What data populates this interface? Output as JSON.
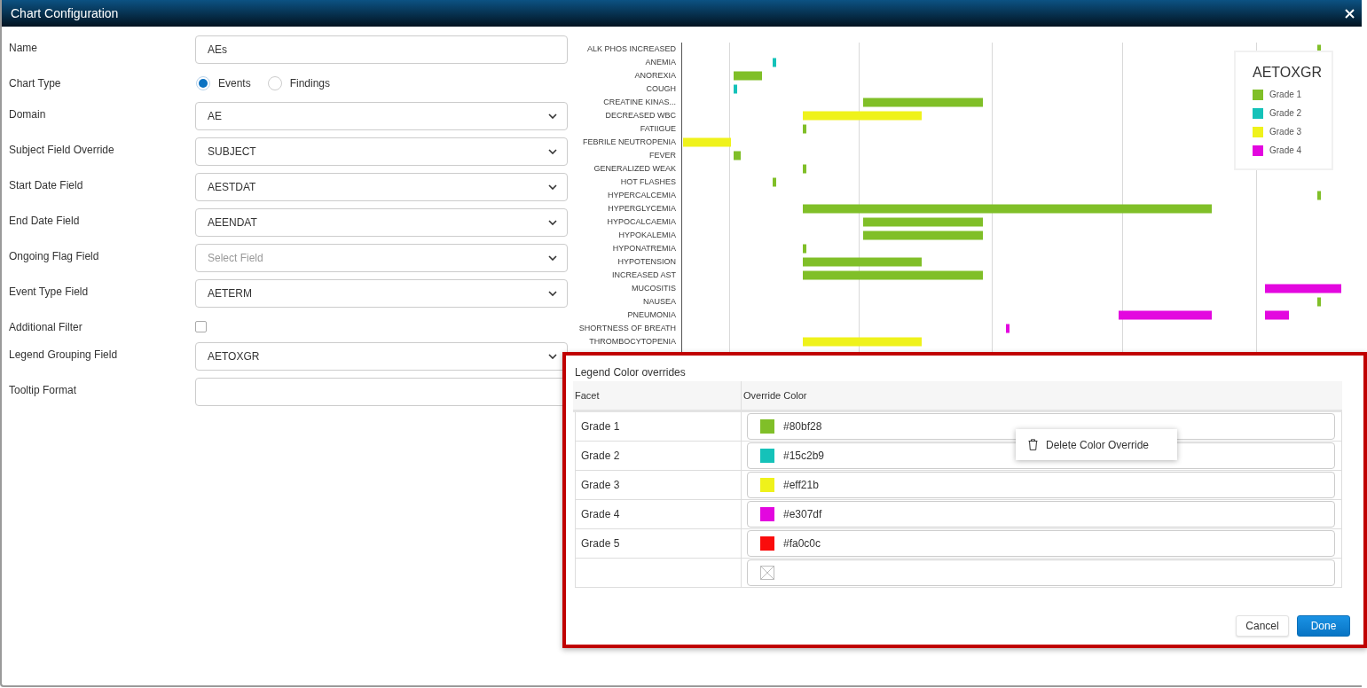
{
  "window": {
    "title": "Chart Configuration"
  },
  "form": {
    "fields": [
      {
        "kind": "text",
        "label": "Name",
        "value": "AEs"
      },
      {
        "kind": "radio",
        "label": "Chart Type",
        "options": [
          {
            "label": "Events",
            "selected": true
          },
          {
            "label": "Findings",
            "selected": false
          }
        ]
      },
      {
        "kind": "select",
        "label": "Domain",
        "value": "AE"
      },
      {
        "kind": "select",
        "label": "Subject Field Override",
        "value": "SUBJECT"
      },
      {
        "kind": "select",
        "label": "Start Date Field",
        "value": "AESTDAT"
      },
      {
        "kind": "select",
        "label": "End Date Field",
        "value": "AEENDAT"
      },
      {
        "kind": "select",
        "label": "Ongoing Flag Field",
        "placeholder": "Select Field"
      },
      {
        "kind": "select",
        "label": "Event Type Field",
        "value": "AETERM"
      },
      {
        "kind": "checkbox",
        "label": "Additional Filter",
        "checked": false
      },
      {
        "kind": "select",
        "label": "Legend Grouping Field",
        "value": "AETOXGR"
      },
      {
        "kind": "text",
        "label": "Tooltip Format"
      }
    ]
  },
  "chart": {
    "row_labels": [
      "ALK PHOS INCREASED",
      "ANEMIA",
      "ANOREXIA",
      "COUGH",
      "CREATINE KINAS...",
      "DECREASED WBC",
      "FATIIGUE",
      "FEBRILE NEUTROPENIA",
      "FEVER",
      "GENERALIZED WEAK",
      "HOT FLASHES",
      "HYPERCALCEMIA",
      "HYPERGLYCEMIA",
      "HYPOCALCAEMIA",
      "HYPOKALEMIA",
      "HYPONATREMIA",
      "HYPOTENSION",
      "INCREASED AST",
      "MUCOSITIS",
      "NAUSEA",
      "PNEUMONIA",
      "SHORTNESS OF BREATH",
      "THROMBOCYTOPENIA"
    ],
    "legend": {
      "title": "AETOXGR",
      "items": [
        {
          "label": "Grade 1",
          "color": "#80bf28"
        },
        {
          "label": "Grade 2",
          "color": "#15c2b9"
        },
        {
          "label": "Grade 3",
          "color": "#eff21b"
        },
        {
          "label": "Grade 4",
          "color": "#e307df"
        }
      ]
    }
  },
  "overrides_panel": {
    "title": "Legend Color overrides",
    "columns": [
      "Facet",
      "Override Color"
    ],
    "rows": [
      {
        "kind": "color",
        "facet": "Grade 1",
        "color": "#80bf28",
        "value": "#80bf28"
      },
      {
        "kind": "color",
        "facet": "Grade 2",
        "color": "#15c2b9",
        "value": "#15c2b9"
      },
      {
        "kind": "color",
        "facet": "Grade 3",
        "color": "#eff21b",
        "value": "#eff21b"
      },
      {
        "kind": "color",
        "facet": "Grade 4",
        "color": "#e307df",
        "value": "#e307df"
      },
      {
        "kind": "color",
        "facet": "Grade 5",
        "color": "#fa0c0c",
        "value": "#fa0c0c"
      },
      {
        "kind": "empty"
      }
    ],
    "context_menu": {
      "items": [
        {
          "label": "Delete Color Override"
        }
      ]
    },
    "buttons": [
      {
        "kind": "cancel",
        "label": "Cancel"
      },
      {
        "kind": "done",
        "label": "Done"
      }
    ]
  }
}
